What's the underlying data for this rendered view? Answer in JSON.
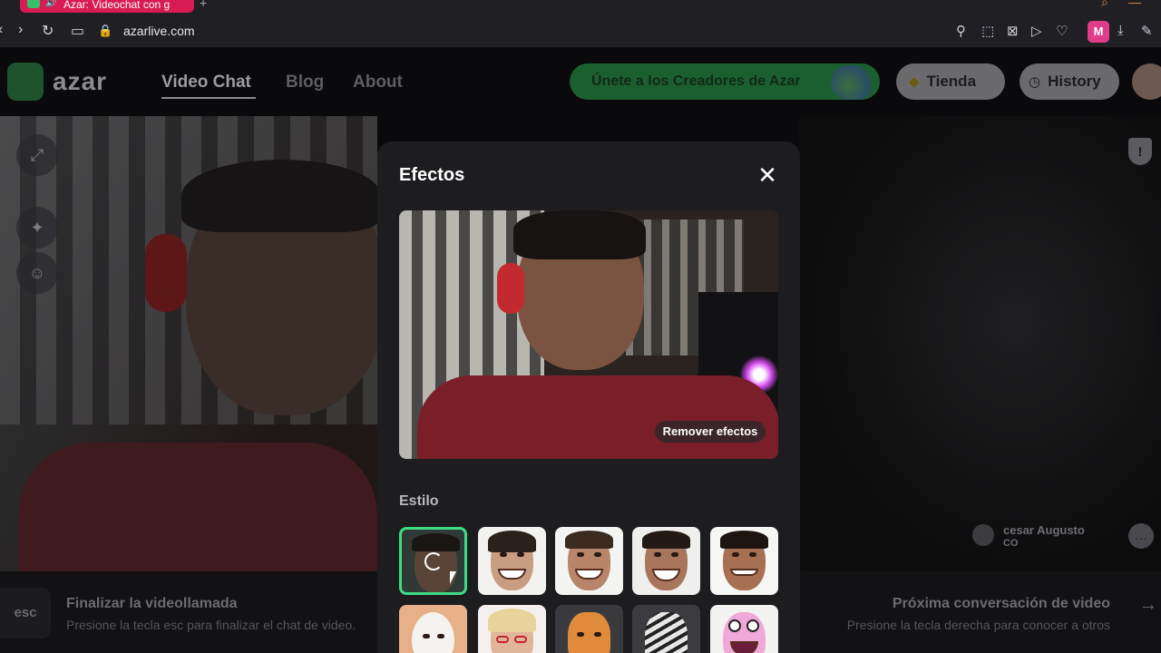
{
  "browser": {
    "tab_title": "Azar: Videochat con g",
    "url": "azarlive.com",
    "profile_badge": "M"
  },
  "header": {
    "logo_text": "azar",
    "nav": [
      "Video Chat",
      "Blog",
      "About"
    ],
    "creators_cta": "Únete a los Creadores de Azar",
    "store_label": "Tienda",
    "history_label": "History"
  },
  "modal": {
    "title": "Efectos",
    "close_glyph": "✕",
    "remove_effects": "Remover efectos",
    "section_label": "Estilo",
    "effects": [
      {
        "name": "original",
        "selected": true
      },
      {
        "name": "caricature-woman"
      },
      {
        "name": "caricature-man-smile"
      },
      {
        "name": "caricature-big-grin"
      },
      {
        "name": "caricature-young-man"
      },
      {
        "name": "white-furry-pet"
      },
      {
        "name": "blonde-woman-glasses"
      },
      {
        "name": "orange-cat"
      },
      {
        "name": "zebra"
      },
      {
        "name": "cartoon-monster"
      }
    ]
  },
  "remote_user": {
    "name": "cesar Augusto",
    "country": "CO"
  },
  "footer": {
    "esc_key": "esc",
    "end_title": "Finalizar la videollamada",
    "end_sub": "Presione la tecla esc para finalizar el chat de video.",
    "next_title": "Próxima conversación de video",
    "next_sub": "Presione la tecla derecha para conocer a otros",
    "next_glyph": "→"
  },
  "colors": {
    "accent_green": "#3ddc84",
    "brand_pink": "#d81b52",
    "modal_bg": "#1d1d20"
  }
}
